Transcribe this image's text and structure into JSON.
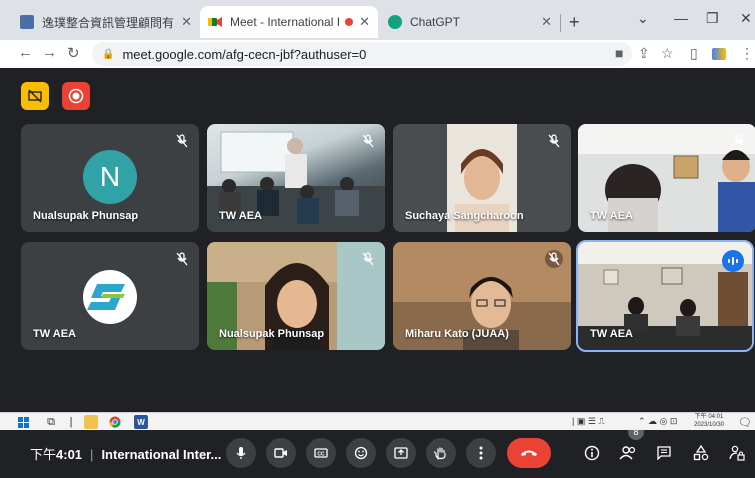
{
  "browser": {
    "tabs": [
      {
        "title": "逸璞整合資訊管理顧問有限公司",
        "favicon": "document-icon"
      },
      {
        "title": "Meet - International Inter",
        "favicon": "meet-icon",
        "recording": true
      },
      {
        "title": "ChatGPT",
        "favicon": "chatgpt-icon"
      }
    ],
    "url": "meet.google.com/afg-cecn-jbf?authuser=0"
  },
  "participants": [
    {
      "name": "Nualsupak Phunsap",
      "type": "avatar",
      "initial": "N",
      "avatar_color": "#31a3a6",
      "muted": true
    },
    {
      "name": "TW AEA",
      "type": "video",
      "muted": true
    },
    {
      "name": "Suchaya Sangcharoon",
      "type": "video",
      "muted": true
    },
    {
      "name": "TW AEA",
      "type": "video",
      "muted": true
    },
    {
      "name": "TW AEA",
      "type": "logo",
      "muted": true
    },
    {
      "name": "Nualsupak Phunsap",
      "type": "video",
      "muted": true
    },
    {
      "name": "Miharu Kato (JUAA)",
      "type": "video",
      "muted": true
    },
    {
      "name": "TW AEA",
      "type": "video",
      "muted": false,
      "speaking": true
    }
  ],
  "controls": {
    "time_prefix": "下午",
    "time": "4:01",
    "meeting_name": "International Inter...",
    "people_count": "8"
  },
  "taskbar": {
    "clock_time": "下午 04:01",
    "clock_date": "2023/10/30"
  },
  "colors": {
    "background": "#202124",
    "tile": "#3c4043",
    "end_call": "#ea4335",
    "accent": "#1a73e8"
  }
}
